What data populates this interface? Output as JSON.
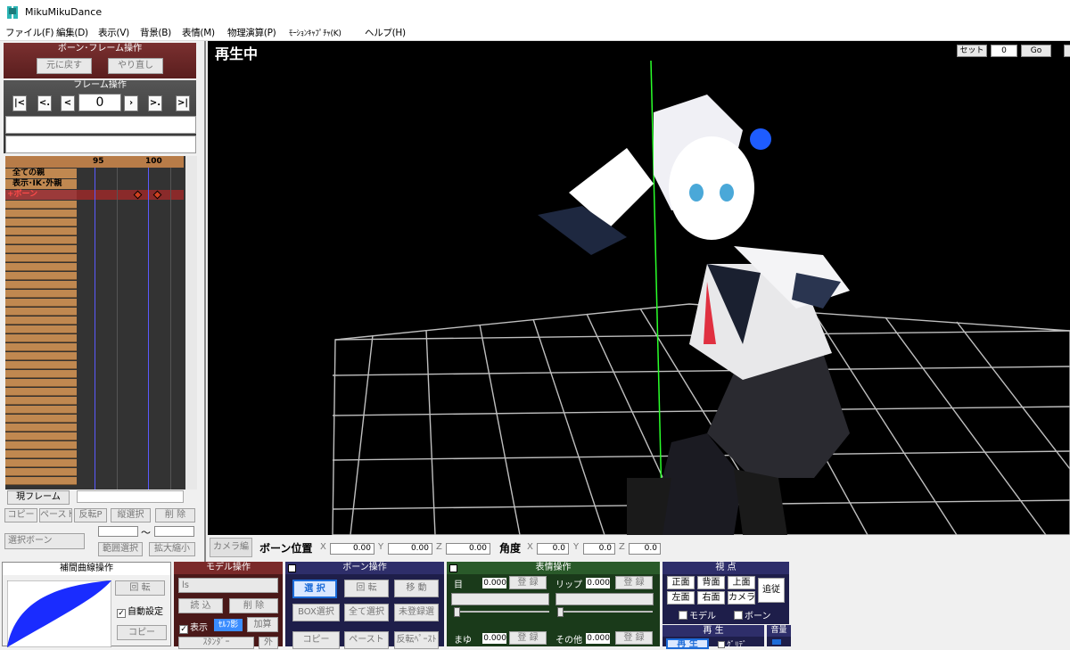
{
  "window": {
    "title": "MikuMikuDance"
  },
  "menu": [
    "ファイル(F)",
    "編集(D)",
    "表示(V)",
    "背景(B)",
    "表情(M)",
    "物理演算(P)",
    "ﾓｰｼｮﾝｷｬﾌﾟﾁｬ(K)",
    "ヘルプ(H)"
  ],
  "bone_frame": {
    "title": "ボーン･フレーム操作",
    "undo": "元に戻す",
    "redo": "やり直し"
  },
  "frame_ops": {
    "title": "フレーム操作",
    "frame_value": "0",
    "nav": [
      "|<",
      "<.",
      "<",
      "|",
      "›",
      ">.",
      ">|"
    ]
  },
  "timeline": {
    "ticks": [
      "95",
      "100"
    ],
    "rows": [
      "全ての親",
      "表示･IK･外親",
      "+ボーン"
    ]
  },
  "left_buttons": {
    "current_frame": "現フレーム",
    "copy": "コピー",
    "paste": "ペースト",
    "reverse": "反転P",
    "vselect": "縦選択",
    "delete": "削 除",
    "select_bone": "選択ボーン",
    "range_select": "範囲選択",
    "scale": "拡大縮小",
    "tilde": "～"
  },
  "viewport": {
    "status": "再生中",
    "set_label": "セット",
    "set_value": "0",
    "go_label": "Go"
  },
  "bone_transform": {
    "camera_tab": "カメラ編",
    "pos_label": "ボーン位置",
    "x": "X",
    "y": "Y",
    "z": "Z",
    "pos_x": "0.00",
    "pos_y": "0.00",
    "pos_z": "0.00",
    "ang_label": "角度",
    "ang_x": "0.0",
    "ang_y": "0.0",
    "ang_z": "0.0"
  },
  "curve_panel": {
    "title": "補間曲線操作",
    "rotate": "回 転",
    "auto": "自動設定",
    "copy": "コピー"
  },
  "model_panel": {
    "title": "モデル操作",
    "model": "ls",
    "load": "読 込",
    "delete": "削 除",
    "display": "表示",
    "selfshadow": "ｾﾙﾌ影",
    "add": "加算",
    "bottom_sel": "ｽﾀﾝﾀﾞｰ",
    "out": "外"
  },
  "bone_panel": {
    "title": "ボーン操作",
    "select": "選 択",
    "rotate": "回 転",
    "move": "移 動",
    "box": "BOX選択",
    "all": "全て選択",
    "unreg": "未登録選",
    "copy": "コピー",
    "paste": "ペースト",
    "rev": "反転ﾍﾟｰｽﾄ"
  },
  "face_panel": {
    "title": "表情操作",
    "eye": "目",
    "eye_val": "0.000",
    "lip": "リップ",
    "lip_val": "0.000",
    "brow": "まゆ",
    "brow_val": "0.000",
    "other": "その他",
    "other_val": "0.000",
    "register": "登 録"
  },
  "view_panel": {
    "title": "視 点",
    "front": "正面",
    "back": "背面",
    "top": "上面",
    "left": "左面",
    "right": "右面",
    "camera": "カメラ",
    "follow": "追従",
    "model": "モデル",
    "bone": "ボーン"
  },
  "play_panel": {
    "title": "再 生",
    "play": "再 生",
    "repeat": "ｸﾞﾘﾃﾞ"
  },
  "volume_panel": {
    "title": "音量"
  }
}
